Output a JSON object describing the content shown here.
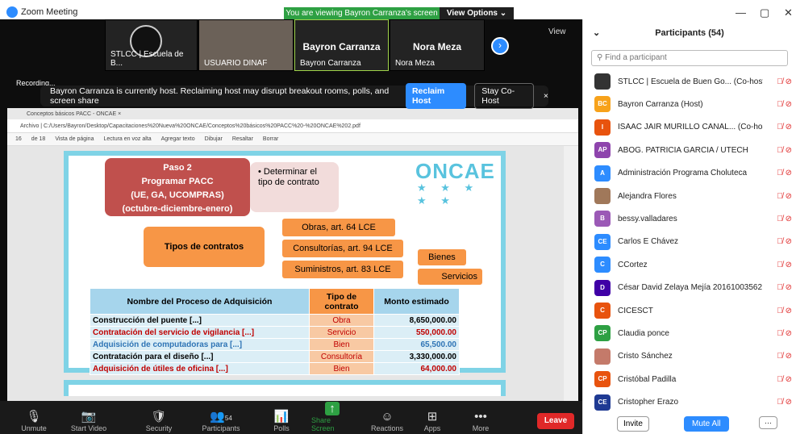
{
  "window": {
    "app_title": "Zoom Meeting",
    "banner": "You are viewing Bayron Carranza's screen",
    "view_options": "View Options ⌄",
    "minimize": "—",
    "restore": "▢",
    "close": "✕"
  },
  "videos": [
    {
      "name": "STLCC | Escuela de B..."
    },
    {
      "name": "USUARIO DINAF"
    },
    {
      "name": "Bayron Carranza",
      "big": "Bayron Carranza"
    },
    {
      "name": "Nora Meza",
      "big": "Nora Meza"
    }
  ],
  "view_label": "View",
  "recording_label": "Recording...",
  "host_notice": {
    "text": "Bayron Carranza is currently host. Reclaiming host may disrupt breakout rooms, polls, and screen share",
    "reclaim": "Reclaim Host",
    "cohost": "Stay Co-Host",
    "close": "×"
  },
  "browser": {
    "tab": "Conceptos básicos PACC - ONCAE  ×",
    "address": "Archivo  |  C:/Users/Bayron/Desktop/Capacitaciones%20Nueva%20ONCAE/Conceptos%20básicos%20PACC%20-%20ONCAE%202.pdf",
    "page": "16",
    "of": "de 18",
    "tools": [
      "Vista de página",
      "Lectura en voz alta",
      "Agregar texto",
      "Dibujar",
      "Resaltar",
      "Borrar"
    ]
  },
  "slide": {
    "paso_lines": [
      "Paso 2",
      "Programar PACC",
      "(UE, GA, UCOMPRAS)",
      "(octubre-diciembre-enero)"
    ],
    "determinar": "• Determinar el tipo de contrato",
    "logo": "ONCAE",
    "stars": "★ ★ ★ ★ ★",
    "tipos": "Tipos de contratos",
    "types": [
      "Obras, art. 64 LCE",
      "Consultorías, art. 94 LCE",
      "Suministros, art. 83 LCE"
    ],
    "sub_types": [
      "Bienes",
      "Servicios"
    ],
    "table_headers": [
      "Nombre del Proceso de Adquisición",
      "Tipo de contrato",
      "Monto estimado"
    ],
    "rows": [
      {
        "name": "Construcción del puente [...]",
        "type": "Obra",
        "amount": "8,650,000.00",
        "color": "#000000"
      },
      {
        "name": "Contratación del servicio de vigilancia [...]",
        "type": "Servicio",
        "amount": "550,000.00",
        "color": "#c00000"
      },
      {
        "name": "Adquisición de computadoras para [...]",
        "type": "Bien",
        "amount": "65,500.00",
        "color": "#2e74b5"
      },
      {
        "name": "Contratación para el diseño [...]",
        "type": "Consultoría",
        "amount": "3,330,000.00",
        "color": "#000000"
      },
      {
        "name": "Adquisición de útiles de oficina [...]",
        "type": "Bien",
        "amount": "64,000.00",
        "color": "#c00000"
      }
    ]
  },
  "toolbar": [
    {
      "label": "Unmute",
      "icon": "🎙"
    },
    {
      "label": "Start Video",
      "icon": "📷"
    },
    {
      "label": "Security",
      "icon": "🛡"
    },
    {
      "label": "Participants",
      "icon": "👥",
      "count": "54"
    },
    {
      "label": "Polls",
      "icon": "📊"
    },
    {
      "label": "Share Screen",
      "icon": "↑"
    },
    {
      "label": "Reactions",
      "icon": "☺"
    },
    {
      "label": "Apps",
      "icon": "⊞"
    },
    {
      "label": "More",
      "icon": "•••"
    }
  ],
  "leave": "Leave",
  "participants": {
    "title": "Participants (54)",
    "search_placeholder": "Find a participant",
    "list": [
      {
        "initials": "",
        "name": "STLCC | Escuela de Buen Go... (Co-host, me)",
        "color": "#333333"
      },
      {
        "initials": "BC",
        "name": "Bayron Carranza (Host)",
        "color": "#f7a21b"
      },
      {
        "initials": "I",
        "name": "ISAAC JAIR MURILLO CANAL... (Co-host)",
        "color": "#e8530e"
      },
      {
        "initials": "AP",
        "name": "ABOG. PATRICIA GARCIA / UTECH",
        "color": "#8e44ad"
      },
      {
        "initials": "A",
        "name": "Administración Programa Choluteca",
        "color": "#2d8cff"
      },
      {
        "initials": "",
        "name": "Alejandra Flores",
        "color": "#a0785a"
      },
      {
        "initials": "B",
        "name": "bessy.valladares",
        "color": "#9b59b6"
      },
      {
        "initials": "CE",
        "name": "Carlos E Chávez",
        "color": "#2d8cff"
      },
      {
        "initials": "C",
        "name": "CCortez",
        "color": "#2d8cff"
      },
      {
        "initials": "D",
        "name": "César David Zelaya Mejía 20161003562",
        "color": "#3f00a6"
      },
      {
        "initials": "C",
        "name": "CICESCT",
        "color": "#e8530e"
      },
      {
        "initials": "CP",
        "name": "Claudia ponce",
        "color": "#2ea043"
      },
      {
        "initials": "",
        "name": "Cristo Sánchez",
        "color": "#c47a6a"
      },
      {
        "initials": "CP",
        "name": "Cristóbal Padilla",
        "color": "#e8530e"
      },
      {
        "initials": "CE",
        "name": "Cristopher Erazo",
        "color": "#1f3a93"
      }
    ],
    "invite": "Invite",
    "mute_all": "Mute All",
    "more": "···"
  }
}
